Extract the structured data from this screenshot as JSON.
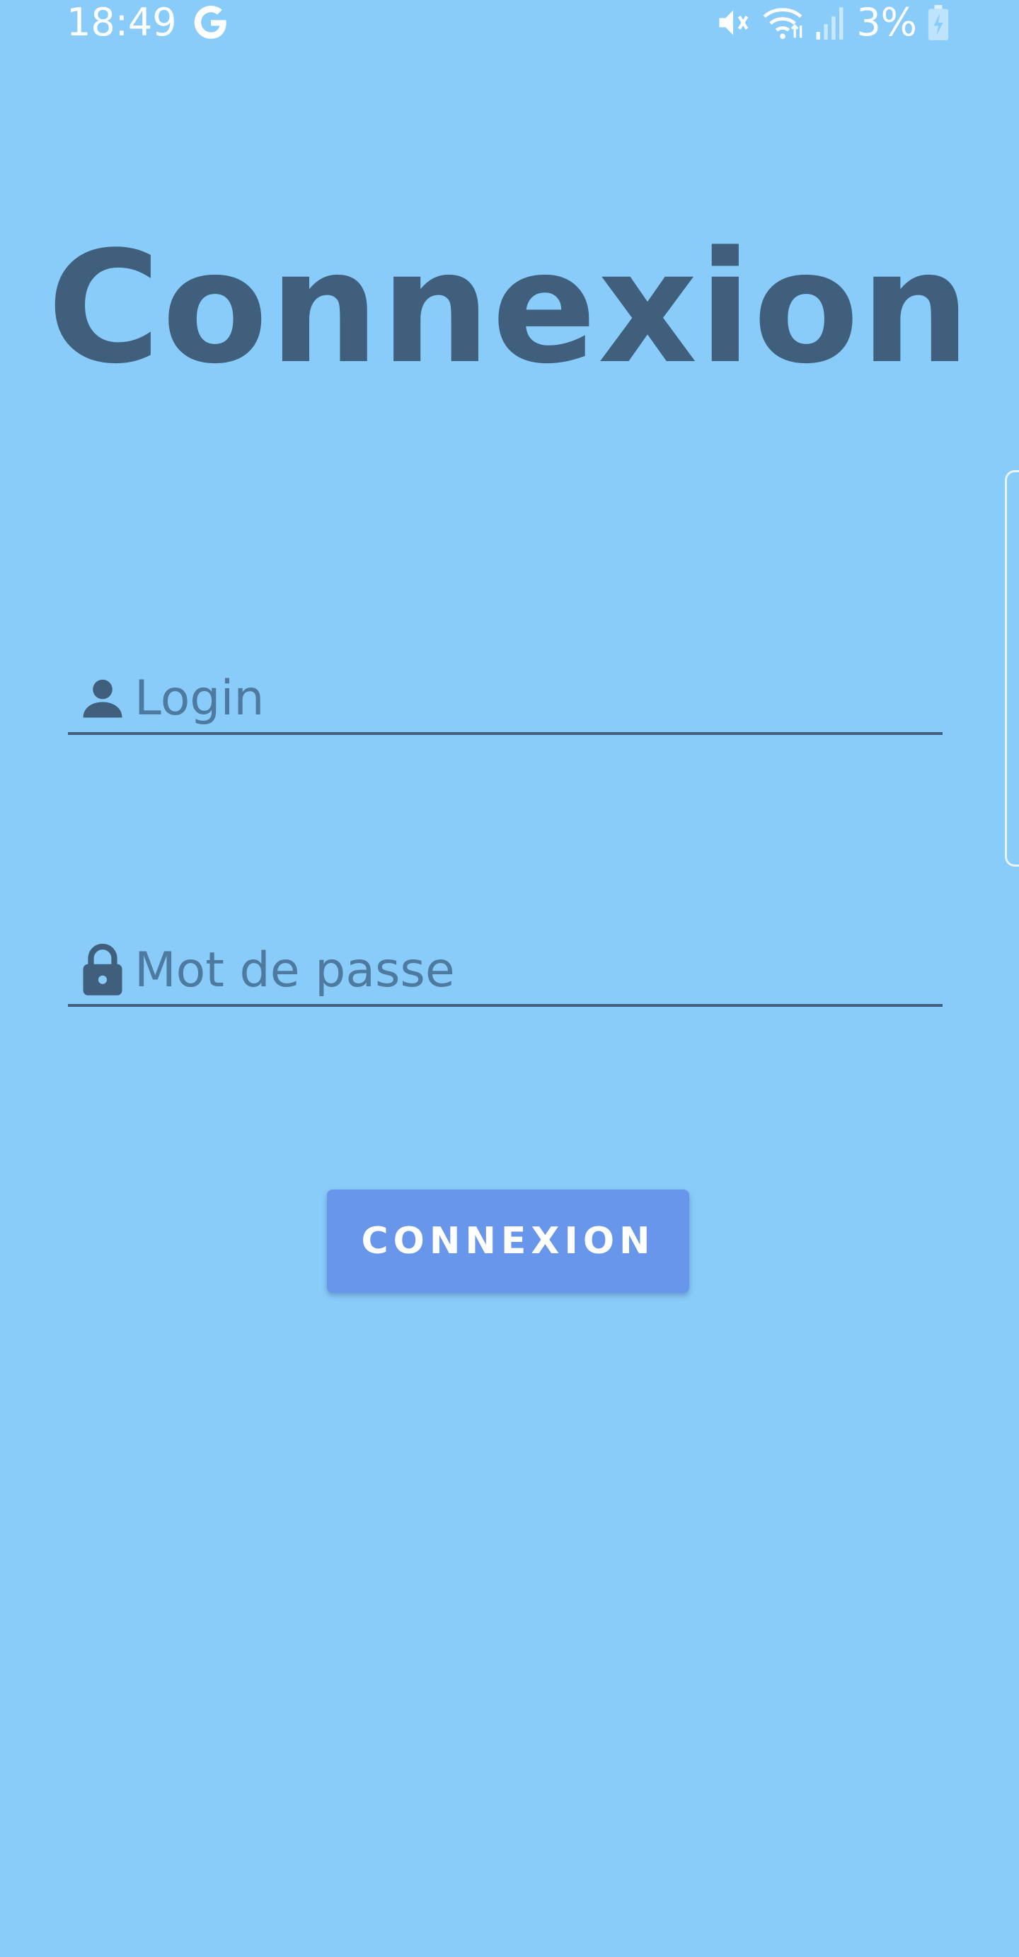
{
  "status_bar": {
    "time": "18:49",
    "battery_percent": "3%",
    "icons": [
      "google-icon",
      "mute-icon",
      "wifi-icon",
      "signal-icon",
      "battery-charging-icon"
    ]
  },
  "page": {
    "title": "Connexion"
  },
  "form": {
    "login_placeholder": "Login",
    "login_value": "",
    "password_placeholder": "Mot de passe",
    "password_value": "",
    "submit_label": "CONNEXION"
  },
  "colors": {
    "background": "#89CCFA",
    "title_text": "#3F5F7C",
    "button": "#6896EA",
    "button_text": "#FFFFFF"
  }
}
